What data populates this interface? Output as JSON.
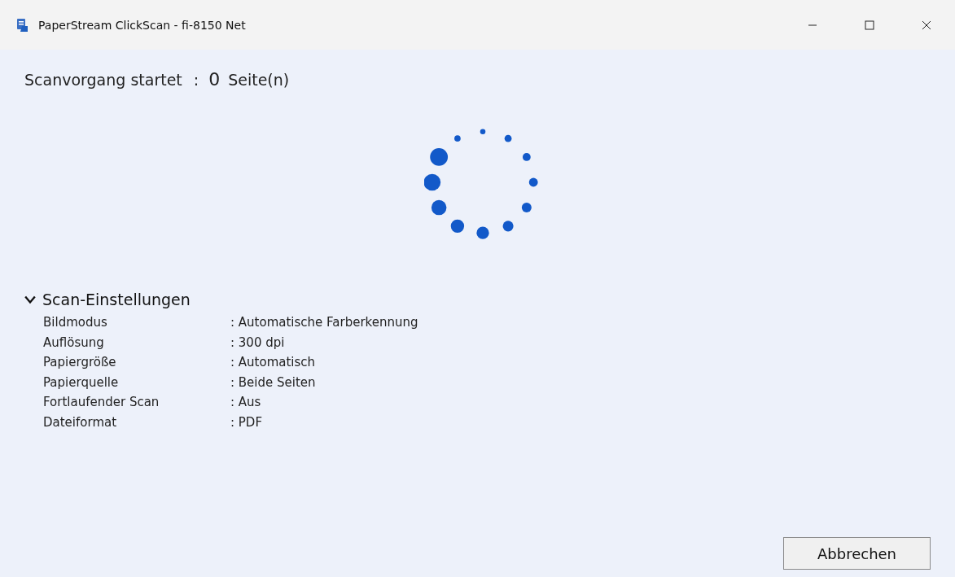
{
  "window": {
    "title": "PaperStream ClickScan - fi-8150 Net"
  },
  "status": {
    "label": "Scanvorgang startet",
    "separator": ":",
    "count": "0",
    "unit": "Seite(n)"
  },
  "settings": {
    "title": "Scan-Einstellungen",
    "expanded": true,
    "rows": [
      {
        "label": "Bildmodus",
        "value": ": Automatische Farberkennung"
      },
      {
        "label": "Auflösung",
        "value": ": 300 dpi"
      },
      {
        "label": "Papiergröße",
        "value": ": Automatisch"
      },
      {
        "label": "Papierquelle",
        "value": ": Beide Seiten"
      },
      {
        "label": "Fortlaufender Scan",
        "value": ": Aus"
      },
      {
        "label": "Dateiformat",
        "value": ": PDF"
      }
    ]
  },
  "buttons": [
    "Abbrechen"
  ]
}
